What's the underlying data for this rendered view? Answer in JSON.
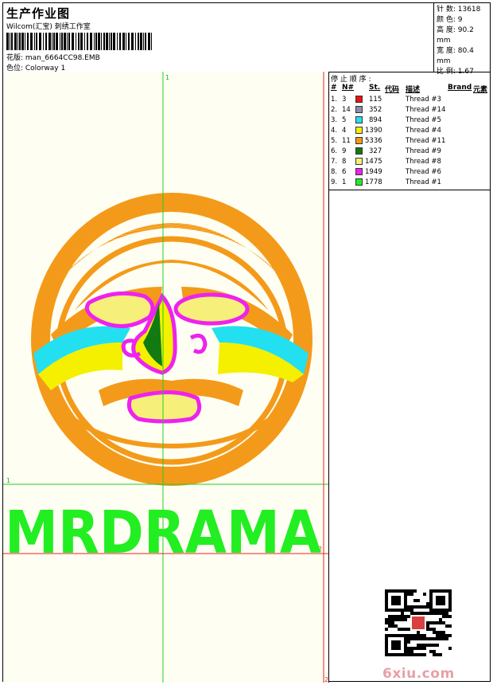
{
  "header": {
    "title": "生产作业图",
    "subtitle": "Wilcom(汇宝) 刺绣工作室",
    "line1": "花版:  man_6664CC98.EMB",
    "line2": "色位:  Colorway 1"
  },
  "stats": [
    "针 数: 13618",
    "颜 色: 9",
    "高 度: 90.2 mm",
    "宽 度: 80.4 mm",
    "比 例: 1.67"
  ],
  "table": {
    "title": "停 止 顺 序 :",
    "headers": [
      "#",
      "N#",
      "St.",
      "代码",
      "描述",
      "Brand",
      "元素"
    ],
    "rows": [
      {
        "idx": "1.",
        "n": "3",
        "color": "#ee1111",
        "st": "115",
        "desc": "Thread #3"
      },
      {
        "idx": "2.",
        "n": "14",
        "color": "#8c8cb0",
        "st": "352",
        "desc": "Thread #14"
      },
      {
        "idx": "3.",
        "n": "5",
        "color": "#22e0f0",
        "st": "894",
        "desc": "Thread #5"
      },
      {
        "idx": "4.",
        "n": "4",
        "color": "#f4f000",
        "st": "1390",
        "desc": "Thread #4"
      },
      {
        "idx": "5.",
        "n": "11",
        "color": "#f49a1a",
        "st": "5336",
        "desc": "Thread #11"
      },
      {
        "idx": "6.",
        "n": "9",
        "color": "#117a11",
        "st": "327",
        "desc": "Thread #9"
      },
      {
        "idx": "7.",
        "n": "8",
        "color": "#f6f07a",
        "st": "1475",
        "desc": "Thread #8"
      },
      {
        "idx": "8.",
        "n": "6",
        "color": "#ee22ee",
        "st": "1949",
        "desc": "Thread #6"
      },
      {
        "idx": "9.",
        "n": "1",
        "color": "#22ee22",
        "st": "1778",
        "desc": "Thread #1"
      }
    ]
  },
  "design": {
    "text": "MRDRAMA",
    "marker1": "1",
    "marker2": "2",
    "colors": {
      "orange": "#f49a1a",
      "yellow": "#f4f000",
      "cyan": "#22e0f0",
      "magenta": "#ee22ee",
      "green": "#117a11",
      "lime": "#22ee22",
      "guide_v": "#22cc22",
      "guide_h": "#ee2222"
    }
  },
  "watermark": "6xiu.com"
}
